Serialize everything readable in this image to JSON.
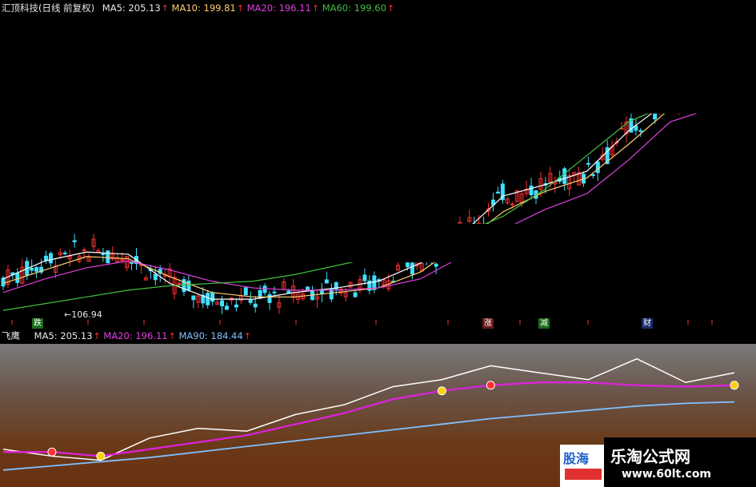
{
  "upper_header": {
    "name": "汇顶科技(日线 前复权)",
    "ma5": "MA5: 205.13",
    "ma10": "MA10: 199.81",
    "ma20": "MA20: 196.11",
    "ma60": "MA60: 199.60",
    "arrow": "↑"
  },
  "lower_header": {
    "name": "飞鹰",
    "ma5": "MA5: 205.13",
    "ma20": "MA20: 196.11",
    "ma90": "MA90: 184.44",
    "arrow": "↑"
  },
  "low_price_label": "106.94",
  "signal_tags": {
    "die": "跌",
    "zhang": "涨",
    "jian": "减",
    "cai": "财"
  },
  "watermark": {
    "main": "乐淘公式网",
    "url": "www.60lt.com",
    "partial": "股海"
  },
  "colors": {
    "up": "#ff3030",
    "down": "#40e0ff",
    "ma5": "#ffffff",
    "ma10": "#ffd070",
    "ma20": "#e040e0",
    "ma60": "#40c040",
    "ma90": "#80c0ff",
    "signal_ma20": "#e020e0"
  },
  "chart_data": [
    {
      "type": "line",
      "series": [
        {
          "name": "MA5",
          "values": [
            120,
            128,
            132,
            131,
            118,
            111,
            111,
            114,
            116,
            119,
            127,
            140,
            157,
            162,
            168,
            186,
            200,
            205
          ]
        },
        {
          "name": "MA10",
          "values": [
            118,
            124,
            130,
            129,
            121,
            114,
            112,
            112,
            114,
            116,
            123,
            136,
            150,
            159,
            165,
            180,
            196,
            200
          ]
        },
        {
          "name": "MA20",
          "values": [
            114,
            120,
            125,
            128,
            124,
            119,
            116,
            115,
            115,
            116,
            120,
            130,
            142,
            151,
            158,
            173,
            190,
            196
          ]
        },
        {
          "name": "MA60",
          "values": [
            106,
            109,
            112,
            115,
            117,
            118,
            119,
            122,
            126,
            130,
            134,
            140,
            148,
            160,
            175,
            190,
            198,
            200
          ]
        }
      ],
      "x": [
        "1",
        "2",
        "3",
        "4",
        "5",
        "6",
        "7",
        "8",
        "9",
        "10",
        "11",
        "12",
        "13",
        "14",
        "15",
        "16",
        "17",
        "18"
      ]
    },
    {
      "type": "line",
      "series": [
        {
          "name": "MA5",
          "values": [
            150,
            145,
            142,
            158,
            165,
            163,
            175,
            182,
            195,
            200,
            210,
            205,
            200,
            215,
            198,
            205
          ]
        },
        {
          "name": "MA20",
          "values": [
            148,
            148,
            145,
            150,
            155,
            160,
            168,
            176,
            186,
            192,
            196,
            198,
            198,
            196,
            195,
            196
          ]
        },
        {
          "name": "MA90",
          "values": [
            135,
            138,
            141,
            144,
            148,
            152,
            156,
            160,
            164,
            168,
            172,
            175,
            178,
            181,
            183,
            184
          ]
        }
      ],
      "x": [
        "1",
        "2",
        "3",
        "4",
        "5",
        "6",
        "7",
        "8",
        "9",
        "10",
        "11",
        "12",
        "13",
        "14",
        "15",
        "16"
      ]
    }
  ]
}
